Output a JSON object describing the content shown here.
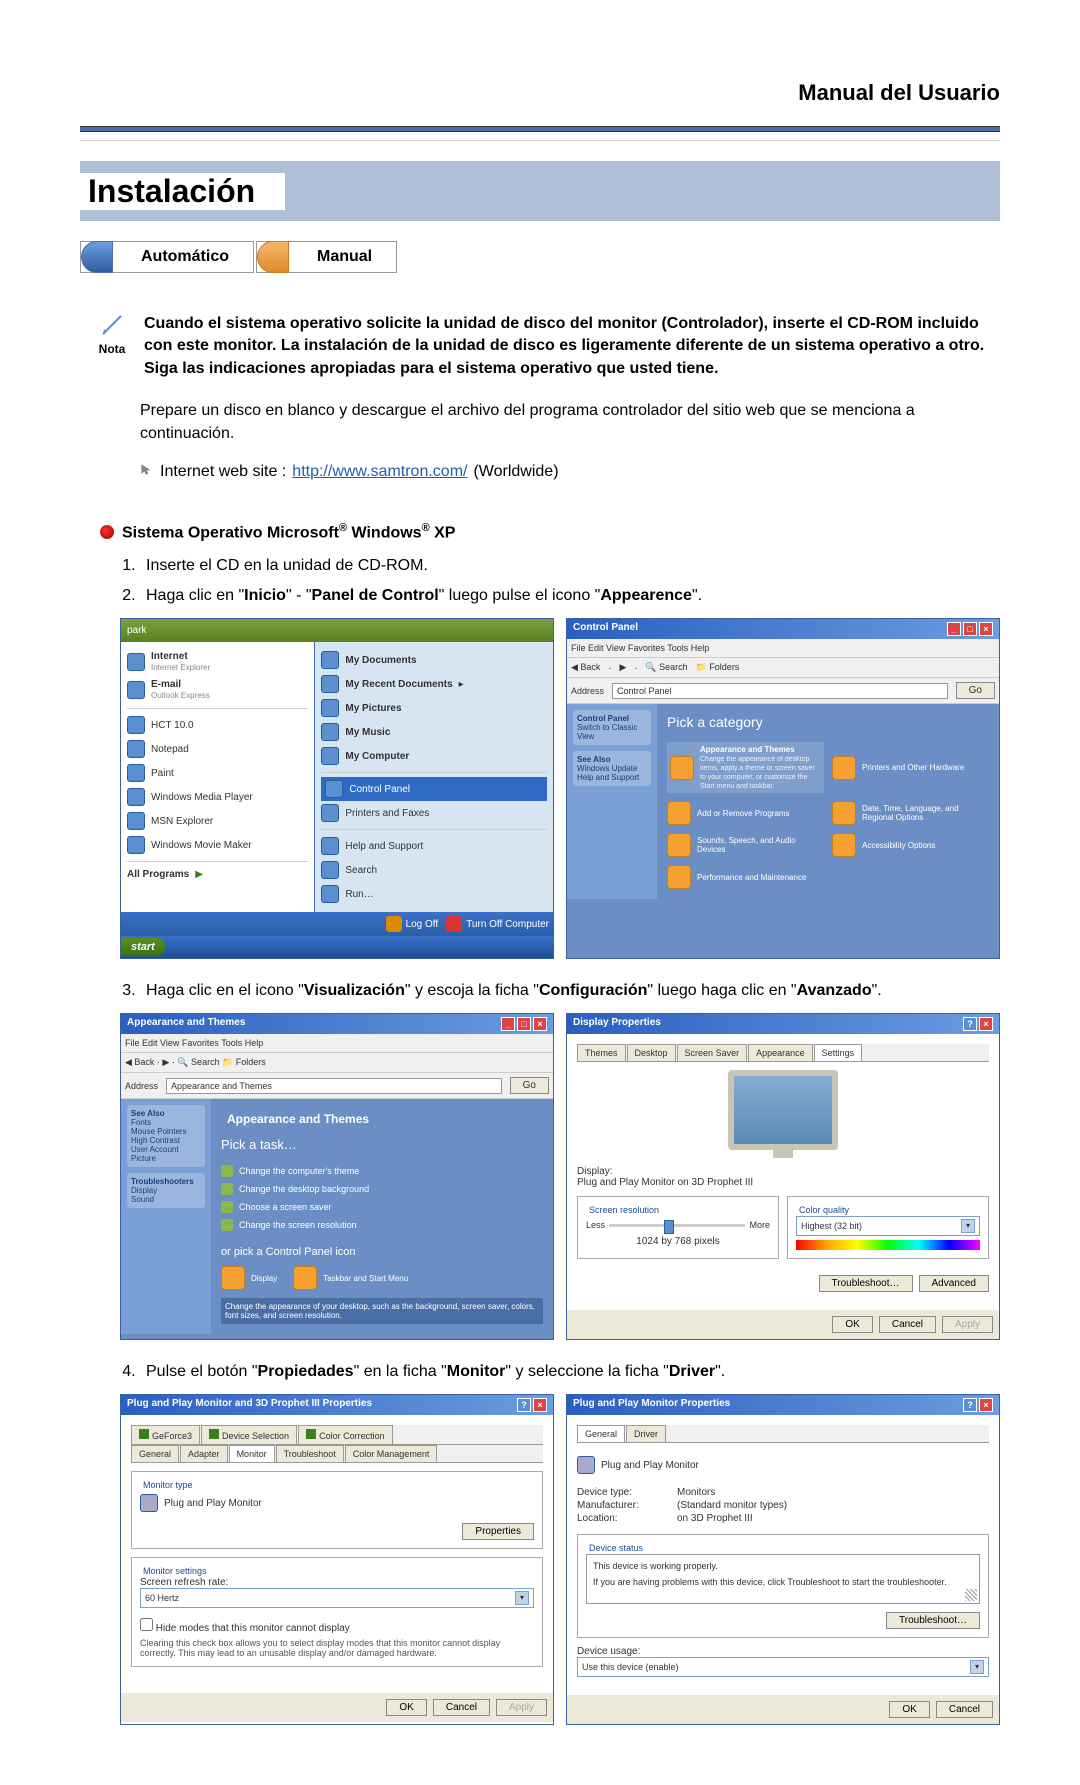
{
  "header": {
    "title": "Manual del Usuario"
  },
  "section": {
    "title": "Instalación"
  },
  "tabs": {
    "auto": "Automático",
    "manual": "Manual"
  },
  "note": {
    "label": "Nota",
    "text": "Cuando el sistema operativo solicite la unidad de disco del monitor (Controlador), inserte el CD-ROM incluido con este monitor. La instalación de la unidad de disco es ligeramente diferente de un sistema operativo a otro. Siga las indicaciones apropiadas para el sistema operativo que usted tiene."
  },
  "para1": "Prepare un disco en blanco y descargue el archivo del programa controlador del sitio web que se menciona a continuación.",
  "weblink": {
    "prefix": "Internet web site : ",
    "url": "http://www.samtron.com/",
    "suffix": " (Worldwide)"
  },
  "os": {
    "prefix": "Sistema Operativo Microsoft",
    "mid": " Windows",
    "suffix": " XP"
  },
  "steps": {
    "s1": "Inserte el CD en la unidad de CD-ROM.",
    "s2a": "Haga clic en \"",
    "s2b": "Inicio",
    "s2c": "\" - \"",
    "s2d": "Panel de Control",
    "s2e": "\" luego pulse el icono \"",
    "s2f": "Appearence",
    "s2g": "\".",
    "s3a": "Haga clic en el icono \"",
    "s3b": "Visualización",
    "s3c": "\" y escoja la ficha \"",
    "s3d": "Configuración",
    "s3e": "\" luego haga clic en \"",
    "s3f": "Avanzado",
    "s3g": "\".",
    "s4a": "Pulse el botón \"",
    "s4b": "Propiedades",
    "s4c": "\" en la ficha \"",
    "s4d": "Monitor",
    "s4e": "\" y seleccione la ficha \"",
    "s4f": "Driver",
    "s4g": "\"."
  },
  "startmenu": {
    "user": "park",
    "left": [
      "Internet",
      "Internet Explorer",
      "E-mail",
      "Outlook Express",
      "HCT 10.0",
      "Notepad",
      "Paint",
      "Windows Media Player",
      "MSN Explorer",
      "Windows Movie Maker"
    ],
    "allprograms": "All Programs",
    "right": [
      "My Documents",
      "My Recent Documents",
      "My Pictures",
      "My Music",
      "My Computer",
      "Control Panel",
      "Printers and Faxes",
      "Help and Support",
      "Search",
      "Run…"
    ],
    "logoff": "Log Off",
    "turnoff": "Turn Off Computer",
    "start": "start"
  },
  "controlpanel": {
    "title": "Control Panel",
    "menu": "File   Edit   View   Favorites   Tools   Help",
    "addr": "Control Panel",
    "side": [
      "Control Panel",
      "Switch to Classic View",
      "See Also",
      "Windows Update",
      "Help and Support"
    ],
    "pick": "Pick a category",
    "cats": [
      {
        "name": "Appearance and Themes",
        "desc": "Change the appearance of desktop items, apply a theme or screen saver to your computer, or customize the Start menu and taskbar."
      },
      {
        "name": "Printers and Other Hardware"
      },
      {
        "name": "Add or Remove Programs"
      },
      {
        "name": "Date, Time, Language, and Regional Options"
      },
      {
        "name": "Sounds, Speech, and Audio Devices"
      },
      {
        "name": "Accessibility Options"
      },
      {
        "name": "Performance and Maintenance"
      }
    ]
  },
  "appthemes": {
    "title": "Appearance and Themes",
    "pick": "Pick a task…",
    "tasks": [
      "Change the computer's theme",
      "Change the desktop background",
      "Choose a screen saver",
      "Change the screen resolution"
    ],
    "orpick": "or pick a Control Panel icon",
    "icons": [
      "Display",
      "Taskbar and Start Menu"
    ],
    "hint": "Change the appearance of your desktop, such as the background, screen saver, colors, font sizes, and screen resolution."
  },
  "displayprops": {
    "title": "Display Properties",
    "tabs": [
      "Themes",
      "Desktop",
      "Screen Saver",
      "Appearance",
      "Settings"
    ],
    "display_lbl": "Display:",
    "display_val": "Plug and Play Monitor on 3D Prophet III",
    "res_legend": "Screen resolution",
    "less": "Less",
    "more": "More",
    "res_val": "1024 by 768 pixels",
    "col_legend": "Color quality",
    "col_val": "Highest (32 bit)",
    "trouble": "Troubleshoot…",
    "adv": "Advanced",
    "ok": "OK",
    "cancel": "Cancel",
    "apply": "Apply"
  },
  "advprops": {
    "title": "Plug and Play Monitor and 3D Prophet III Properties",
    "toptabs": [
      "GeForce3",
      "Device Selection",
      "Color Correction"
    ],
    "bottabs": [
      "General",
      "Adapter",
      "Monitor",
      "Troubleshoot",
      "Color Management"
    ],
    "montype_legend": "Monitor type",
    "montype": "Plug and Play Monitor",
    "props_btn": "Properties",
    "monset_legend": "Monitor settings",
    "refresh_lbl": "Screen refresh rate:",
    "refresh_val": "60 Hertz",
    "hide": "Hide modes that this monitor cannot display",
    "hidetext": "Clearing this check box allows you to select display modes that this monitor cannot display correctly. This may lead to an unusable display and/or damaged hardware.",
    "ok": "OK",
    "cancel": "Cancel",
    "apply": "Apply"
  },
  "monprops": {
    "title": "Plug and Play Monitor Properties",
    "tabs": [
      "General",
      "Driver"
    ],
    "name": "Plug and Play Monitor",
    "devtype_k": "Device type:",
    "devtype_v": "Monitors",
    "manu_k": "Manufacturer:",
    "manu_v": "(Standard monitor types)",
    "loc_k": "Location:",
    "loc_v": "on 3D Prophet III",
    "status_legend": "Device status",
    "status1": "This device is working properly.",
    "status2": "If you are having problems with this device, click Troubleshoot to start the troubleshooter.",
    "trouble": "Troubleshoot…",
    "usage_lbl": "Device usage:",
    "usage_val": "Use this device (enable)",
    "ok": "OK",
    "cancel": "Cancel"
  }
}
